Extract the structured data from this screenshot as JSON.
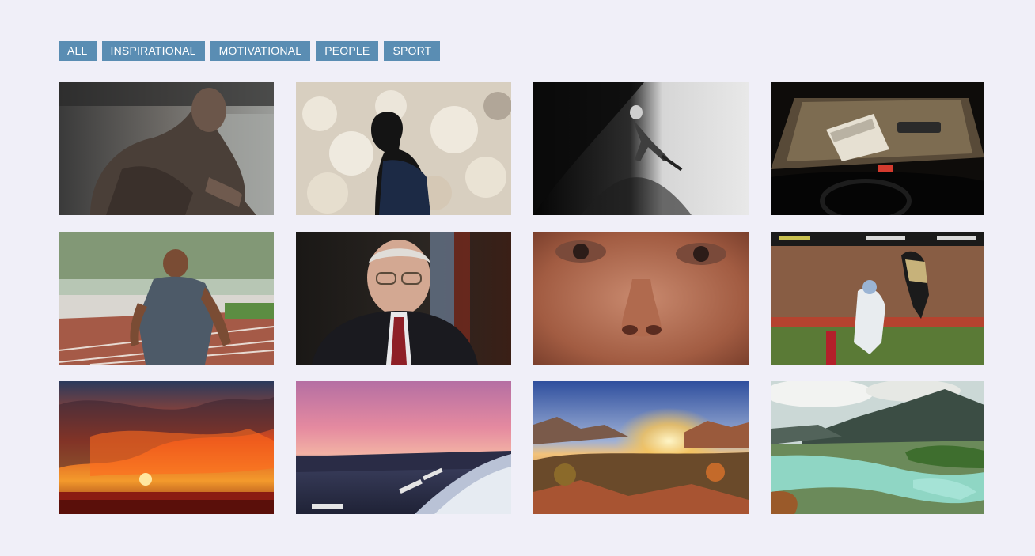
{
  "filters": {
    "all": "ALL",
    "inspirational": "INSPIRATIONAL",
    "motivational": "MOTIVATIONAL",
    "people": "PEOPLE",
    "sport": "SPORT"
  },
  "colors": {
    "background": "#f0eff8",
    "filter_button": "#5a8db3",
    "filter_text": "#ffffff"
  }
}
